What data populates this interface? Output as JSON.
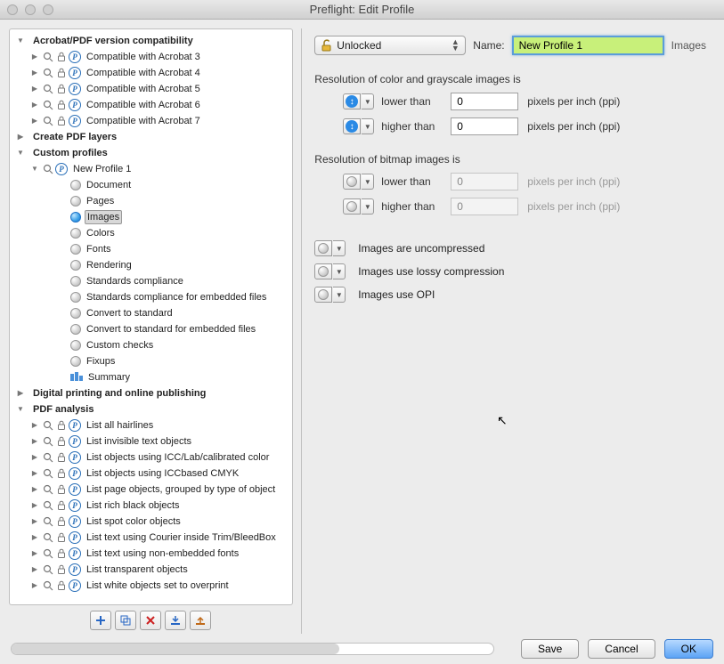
{
  "window": {
    "title": "Preflight: Edit Profile"
  },
  "header": {
    "lock_label": "Unlocked",
    "name_label": "Name:",
    "name_value": "New Profile 1",
    "category": "Images"
  },
  "right": {
    "section1": "Resolution of color and grayscale images is",
    "section2": "Resolution of bitmap images is",
    "lower_than": "lower than",
    "higher_than": "higher than",
    "val_color_lower": "0",
    "val_color_higher": "0",
    "val_bitmap_lower": "0",
    "val_bitmap_higher": "0",
    "unit": "pixels per inch (ppi)",
    "chk_uncompressed": "Images are uncompressed",
    "chk_lossy": "Images use lossy compression",
    "chk_opi": "Images use OPI"
  },
  "tree": {
    "cat_compat": "Acrobat/PDF version compatibility",
    "compat": [
      "Compatible with Acrobat 3",
      "Compatible with Acrobat 4",
      "Compatible with Acrobat 5",
      "Compatible with Acrobat 6",
      "Compatible with Acrobat 7"
    ],
    "cat_layers": "Create PDF layers",
    "cat_custom": "Custom profiles",
    "new_profile": "New Profile 1",
    "children": [
      "Document",
      "Pages",
      "Images",
      "Colors",
      "Fonts",
      "Rendering",
      "Standards compliance",
      "Standards compliance for embedded files",
      "Convert to standard",
      "Convert to standard for embedded files",
      "Custom checks",
      "Fixups",
      "Summary"
    ],
    "cat_digital": "Digital printing and online publishing",
    "cat_analysis": "PDF analysis",
    "analysis": [
      "List all hairlines",
      "List invisible text objects",
      "List objects using ICC/Lab/calibrated color",
      "List objects using ICCbased CMYK",
      "List page objects, grouped by type of object",
      "List rich black objects",
      "List spot color objects",
      "List text using Courier inside Trim/BleedBox",
      "List text using non-embedded fonts",
      "List transparent objects",
      "List white objects set to overprint"
    ]
  },
  "buttons": {
    "save": "Save",
    "cancel": "Cancel",
    "ok": "OK"
  }
}
